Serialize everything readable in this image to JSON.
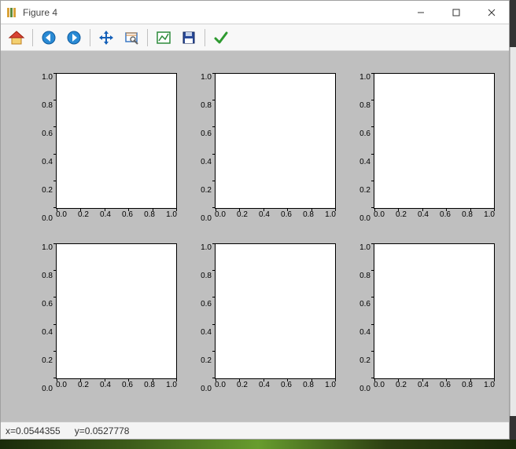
{
  "window": {
    "title": "Figure 4"
  },
  "toolbar": {
    "home_tip": "Home",
    "back_tip": "Back",
    "forward_tip": "Forward",
    "pan_tip": "Pan",
    "zoom_tip": "Zoom",
    "subplots_tip": "Subplots",
    "save_tip": "Save",
    "ok_tip": "OK"
  },
  "status": {
    "x_label": "x=0.0544355",
    "y_label": "y=0.0527778"
  },
  "chart_data": [
    {
      "type": "line",
      "row": 0,
      "col": 0,
      "x": [],
      "y": [],
      "xlim": [
        0.0,
        1.0
      ],
      "ylim": [
        0.0,
        1.0
      ],
      "xticks": [
        "0.0",
        "0.2",
        "0.4",
        "0.6",
        "0.8",
        "1.0"
      ],
      "yticks": [
        "0.0",
        "0.2",
        "0.4",
        "0.6",
        "0.8",
        "1.0"
      ]
    },
    {
      "type": "line",
      "row": 0,
      "col": 1,
      "x": [],
      "y": [],
      "xlim": [
        0.0,
        1.0
      ],
      "ylim": [
        0.0,
        1.0
      ],
      "xticks": [
        "0.0",
        "0.2",
        "0.4",
        "0.6",
        "0.8",
        "1.0"
      ],
      "yticks": [
        "0.0",
        "0.2",
        "0.4",
        "0.6",
        "0.8",
        "1.0"
      ]
    },
    {
      "type": "line",
      "row": 0,
      "col": 2,
      "x": [],
      "y": [],
      "xlim": [
        0.0,
        1.0
      ],
      "ylim": [
        0.0,
        1.0
      ],
      "xticks": [
        "0.0",
        "0.2",
        "0.4",
        "0.6",
        "0.8",
        "1.0"
      ],
      "yticks": [
        "0.0",
        "0.2",
        "0.4",
        "0.6",
        "0.8",
        "1.0"
      ]
    },
    {
      "type": "line",
      "row": 1,
      "col": 0,
      "x": [],
      "y": [],
      "xlim": [
        0.0,
        1.0
      ],
      "ylim": [
        0.0,
        1.0
      ],
      "xticks": [
        "0.0",
        "0.2",
        "0.4",
        "0.6",
        "0.8",
        "1.0"
      ],
      "yticks": [
        "0.0",
        "0.2",
        "0.4",
        "0.6",
        "0.8",
        "1.0"
      ]
    },
    {
      "type": "line",
      "row": 1,
      "col": 1,
      "x": [],
      "y": [],
      "xlim": [
        0.0,
        1.0
      ],
      "ylim": [
        0.0,
        1.0
      ],
      "xticks": [
        "0.0",
        "0.2",
        "0.4",
        "0.6",
        "0.8",
        "1.0"
      ],
      "yticks": [
        "0.0",
        "0.2",
        "0.4",
        "0.6",
        "0.8",
        "1.0"
      ]
    },
    {
      "type": "line",
      "row": 1,
      "col": 2,
      "x": [],
      "y": [],
      "xlim": [
        0.0,
        1.0
      ],
      "ylim": [
        0.0,
        1.0
      ],
      "xticks": [
        "0.0",
        "0.2",
        "0.4",
        "0.6",
        "0.8",
        "1.0"
      ],
      "yticks": [
        "0.0",
        "0.2",
        "0.4",
        "0.6",
        "0.8",
        "1.0"
      ]
    }
  ]
}
